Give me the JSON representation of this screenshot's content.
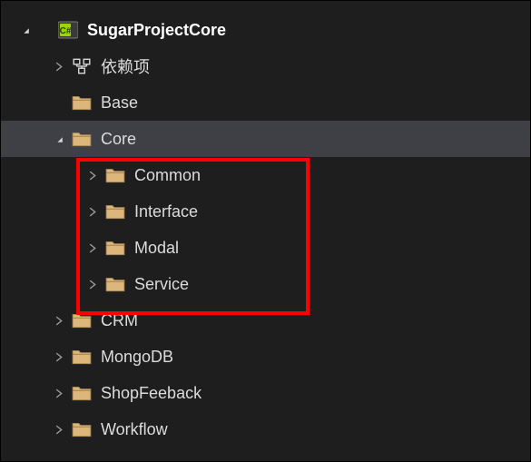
{
  "tree": {
    "partial_top_label": "...",
    "project": {
      "name": "SugarProjectCore",
      "icon": "csharp-project",
      "expanded": true,
      "children": [
        {
          "name": "依赖项",
          "icon": "dependencies",
          "expanded": false,
          "hasChildren": true
        },
        {
          "name": "Base",
          "icon": "folder",
          "expanded": false,
          "hasChildren": false
        },
        {
          "name": "Core",
          "icon": "folder",
          "expanded": true,
          "hasChildren": true,
          "selected": true,
          "children": [
            {
              "name": "Common",
              "icon": "folder",
              "expanded": false,
              "hasChildren": true
            },
            {
              "name": "Interface",
              "icon": "folder",
              "expanded": false,
              "hasChildren": true
            },
            {
              "name": "Modal",
              "icon": "folder",
              "expanded": false,
              "hasChildren": true
            },
            {
              "name": "Service",
              "icon": "folder",
              "expanded": false,
              "hasChildren": true
            }
          ]
        },
        {
          "name": "CRM",
          "icon": "folder",
          "expanded": false,
          "hasChildren": true
        },
        {
          "name": "MongoDB",
          "icon": "folder",
          "expanded": false,
          "hasChildren": true
        },
        {
          "name": "ShopFeeback",
          "icon": "folder",
          "expanded": false,
          "hasChildren": true
        },
        {
          "name": "Workflow",
          "icon": "folder",
          "expanded": false,
          "hasChildren": true
        }
      ]
    }
  },
  "colors": {
    "bg": "#1e1e1e",
    "selected": "#3f3f46",
    "text": "#dcdcdc",
    "folder": "#dcb67a",
    "csharp_bg": "#9bd600",
    "highlight": "#ff0000"
  }
}
